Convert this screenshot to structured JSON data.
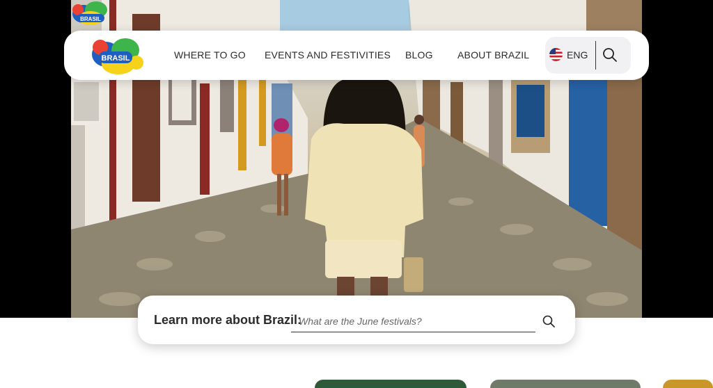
{
  "header": {
    "logo_text": "BRASIL",
    "nav": [
      {
        "label": "WHERE TO GO"
      },
      {
        "label": "EVENTS AND FESTIVITIES"
      },
      {
        "label": "BLOG"
      },
      {
        "label": "ABOUT BRAZIL"
      }
    ],
    "language": {
      "label": "ENG",
      "flag_icon": "us-flag-icon"
    },
    "search_icon": "search-icon"
  },
  "hero": {
    "corner_logo_text": "BRASIL"
  },
  "search_bar": {
    "label": "Learn more about Brazil:",
    "placeholder": "What are the June festivals?",
    "icon": "search-icon"
  },
  "colors": {
    "header_bg": "#ffffff",
    "text": "#2a2a2a",
    "logo_blue": "#1f5fbf",
    "logo_yellow": "#f6d21a",
    "logo_green": "#3db54a",
    "logo_red": "#e94234"
  }
}
